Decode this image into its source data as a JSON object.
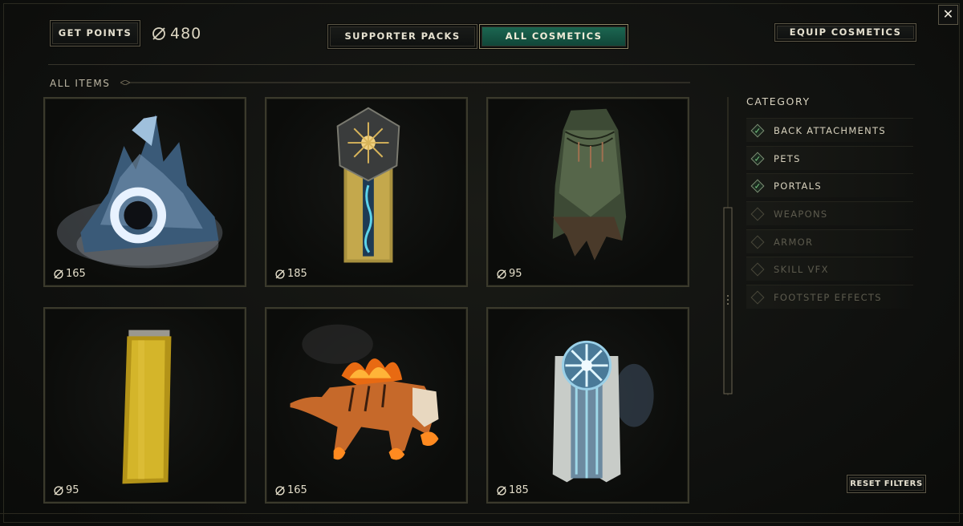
{
  "header": {
    "get_points_label": "GET POINTS",
    "points_balance": "480",
    "tabs": [
      {
        "label": "SUPPORTER PACKS",
        "active": false
      },
      {
        "label": "ALL COSMETICS",
        "active": true
      }
    ],
    "equip_label": "EQUIP COSMETICS",
    "close_symbol": "✕"
  },
  "section_title": "ALL ITEMS",
  "items": [
    {
      "name": "Frost crystal portal",
      "icon": "ice-portal-icon",
      "price": "165"
    },
    {
      "name": "Sun crest banner",
      "icon": "sun-banner-icon",
      "price": "185"
    },
    {
      "name": "Green tattered cloak",
      "icon": "cloak-icon",
      "price": "95"
    },
    {
      "name": "Golden cape",
      "icon": "golden-cape-icon",
      "price": "95"
    },
    {
      "name": "Flaming tiger pet",
      "icon": "fire-tiger-icon",
      "price": "165"
    },
    {
      "name": "Frost star banner",
      "icon": "frost-banner-icon",
      "price": "185"
    }
  ],
  "sidebar": {
    "title": "CATEGORY",
    "categories": [
      {
        "label": "BACK ATTACHMENTS",
        "checked": true,
        "enabled": true
      },
      {
        "label": "PETS",
        "checked": true,
        "enabled": true
      },
      {
        "label": "PORTALS",
        "checked": true,
        "enabled": true
      },
      {
        "label": "WEAPONS",
        "checked": false,
        "enabled": false
      },
      {
        "label": "ARMOR",
        "checked": false,
        "enabled": false
      },
      {
        "label": "SKILL VFX",
        "checked": false,
        "enabled": false
      },
      {
        "label": "FOOTSTEP EFFECTS",
        "checked": false,
        "enabled": false
      }
    ],
    "reset_label": "RESET FILTERS"
  },
  "colors": {
    "active_tab": "#1d6a54",
    "gold_border": "#5b5646",
    "check_green": "#7fd48a",
    "background": "#111210"
  }
}
